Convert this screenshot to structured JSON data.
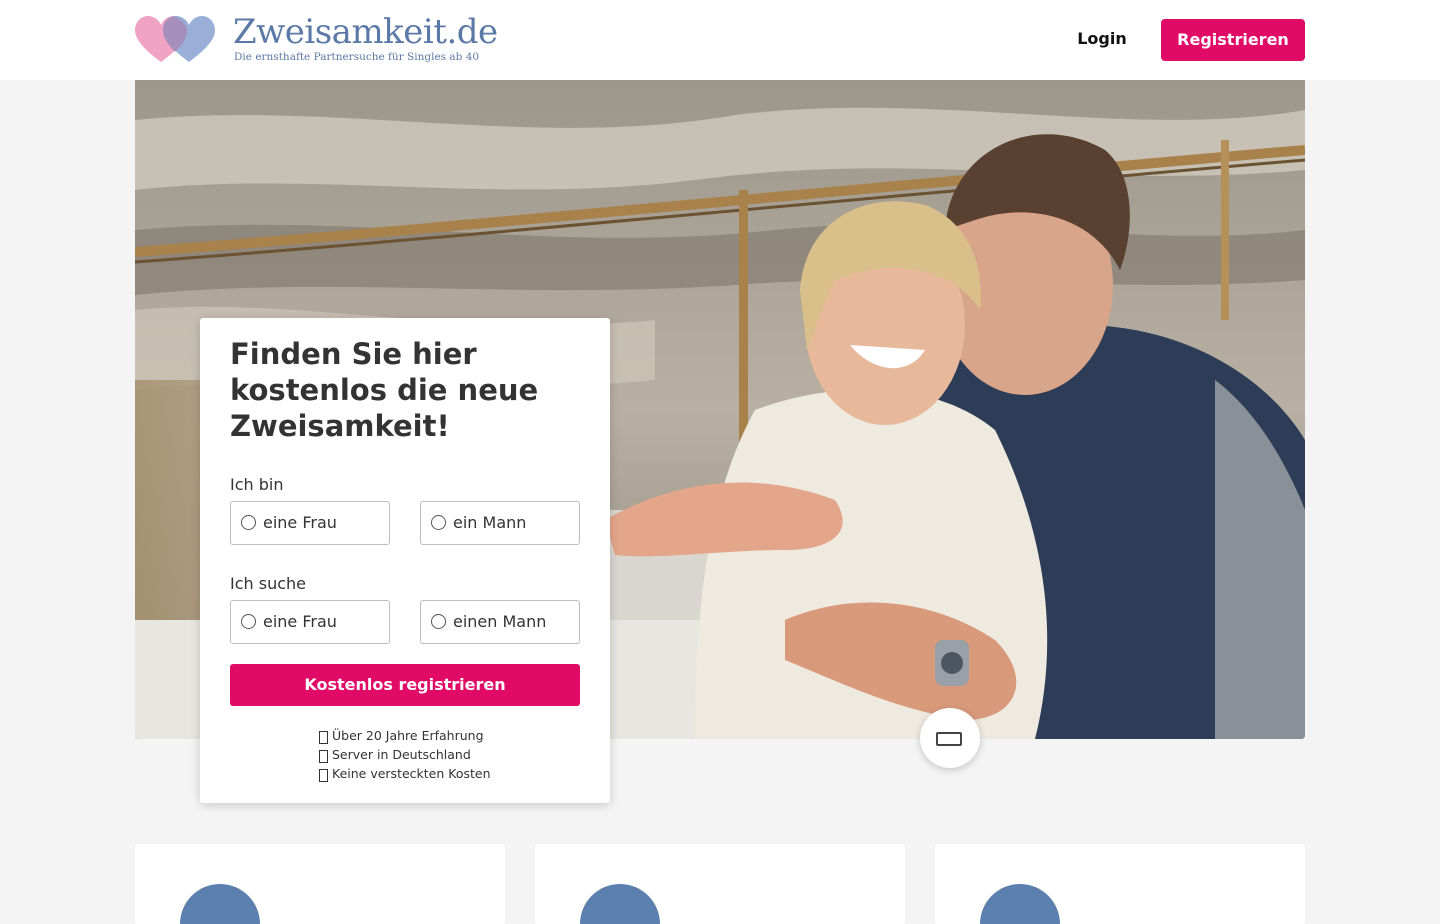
{
  "header": {
    "logo_title": "Zweisamkeit.de",
    "logo_tagline": "Die ernsthafte Partnersuche für Singles ab 40",
    "login_label": "Login",
    "register_label": "Registrieren"
  },
  "colors": {
    "accent": "#e20a67",
    "brand_blue": "#5b79a6",
    "heart_pink": "#f0a3c2",
    "heart_blue": "#8ea6d4"
  },
  "form": {
    "title": "Finden Sie hier kostenlos die neue Zweisamkeit!",
    "i_am_label": "Ich bin",
    "i_am_options": [
      "eine Frau",
      "ein Mann"
    ],
    "seeking_label": "Ich suche",
    "seeking_options": [
      "eine Frau",
      "einen Mann"
    ],
    "submit_label": "Kostenlos registrieren",
    "benefits": [
      "Über 20 Jahre Erfahrung",
      "Server in Deutschland",
      "Keine versteckten Kosten"
    ]
  },
  "hero": {
    "image_alt_icon": "photo-couple"
  },
  "icons": {
    "floating_button": "window-icon",
    "benefit_icon": "check-icon"
  }
}
